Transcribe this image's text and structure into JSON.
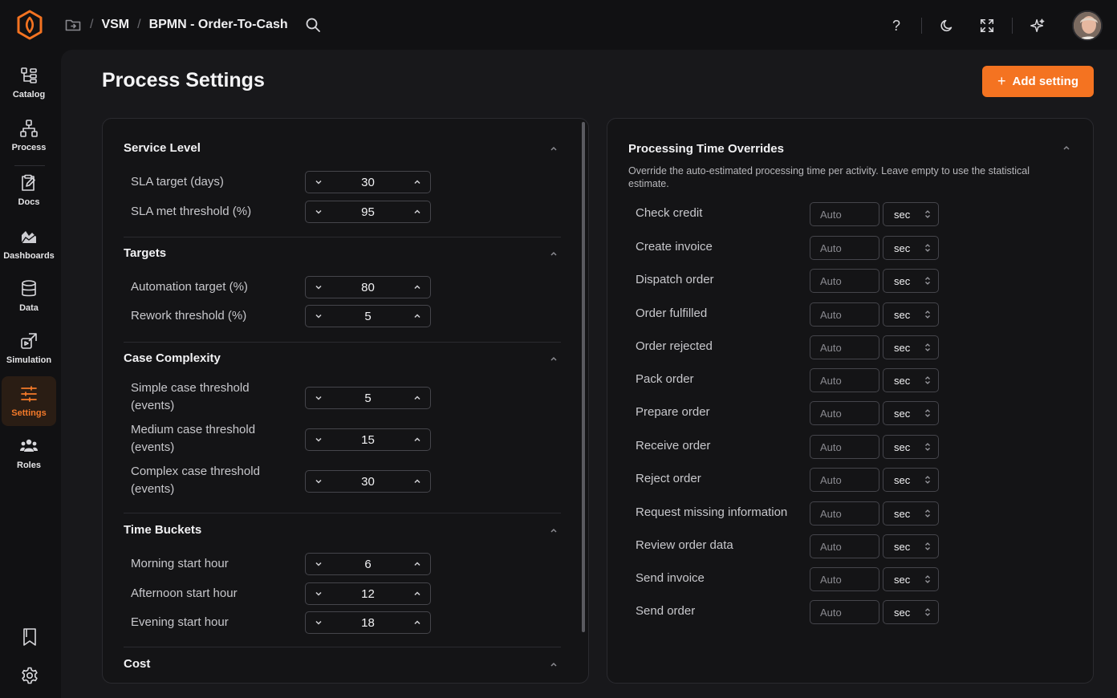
{
  "breadcrumb": {
    "items": [
      "VSM",
      "BPMN - Order-To-Cash"
    ]
  },
  "sidebar": {
    "items": [
      {
        "label": "Catalog",
        "icon": "catalog-icon"
      },
      {
        "label": "Process",
        "icon": "process-icon"
      },
      {
        "label": "Docs",
        "icon": "docs-icon"
      },
      {
        "label": "Dashboards",
        "icon": "dashboards-icon"
      },
      {
        "label": "Data",
        "icon": "database-icon"
      },
      {
        "label": "Simulation",
        "icon": "simulation-icon"
      },
      {
        "label": "Settings",
        "icon": "sliders-icon",
        "active": true
      },
      {
        "label": "Roles",
        "icon": "users-icon"
      }
    ]
  },
  "topbar": {
    "help_label": "?"
  },
  "page": {
    "title": "Process Settings",
    "add_button": "Add setting"
  },
  "settings": {
    "sections": [
      {
        "title": "Service Level",
        "rows": [
          {
            "label": "SLA target (days)",
            "value": "30"
          },
          {
            "label": "SLA met threshold (%)",
            "value": "95"
          }
        ]
      },
      {
        "title": "Targets",
        "rows": [
          {
            "label": "Automation target (%)",
            "value": "80"
          },
          {
            "label": "Rework threshold (%)",
            "value": "5"
          }
        ]
      },
      {
        "title": "Case Complexity",
        "rows": [
          {
            "label": "Simple case threshold (events)",
            "value": "5"
          },
          {
            "label": "Medium case threshold (events)",
            "value": "15"
          },
          {
            "label": "Complex case threshold (events)",
            "value": "30"
          }
        ]
      },
      {
        "title": "Time Buckets",
        "rows": [
          {
            "label": "Morning start hour",
            "value": "6"
          },
          {
            "label": "Afternoon start hour",
            "value": "12"
          },
          {
            "label": "Evening start hour",
            "value": "18"
          }
        ]
      },
      {
        "title": "Cost",
        "rows": []
      }
    ]
  },
  "overrides": {
    "title": "Processing Time Overrides",
    "description": "Override the auto-estimated processing time per activity. Leave empty to use the statistical estimate.",
    "placeholder": "Auto",
    "unit": "sec",
    "activities": [
      "Check credit",
      "Create invoice",
      "Dispatch order",
      "Order fulfilled",
      "Order rejected",
      "Pack order",
      "Prepare order",
      "Receive order",
      "Reject order",
      "Request missing information",
      "Review order data",
      "Send invoice",
      "Send order"
    ]
  },
  "colors": {
    "accent": "#f47321",
    "background": "#111113",
    "panel": "#141416"
  }
}
